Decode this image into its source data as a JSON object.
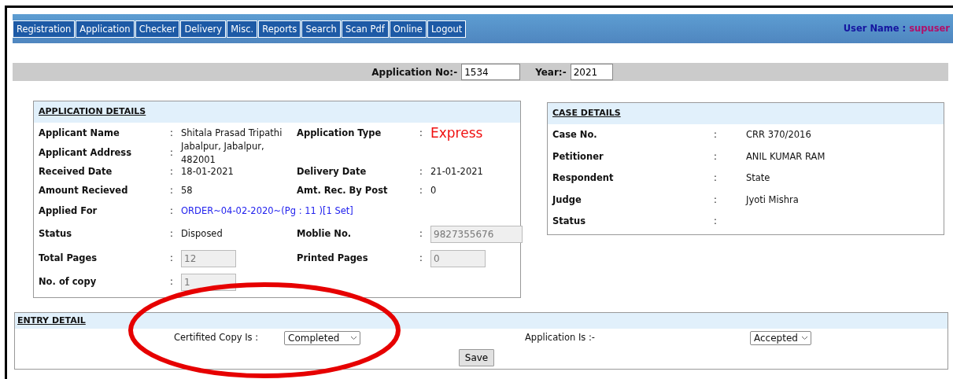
{
  "menu": [
    {
      "label": "Registration"
    },
    {
      "label": "Application"
    },
    {
      "label": "Checker"
    },
    {
      "label": "Delivery"
    },
    {
      "label": "Misc."
    },
    {
      "label": "Reports"
    },
    {
      "label": "Search"
    },
    {
      "label": "Scan Pdf"
    },
    {
      "label": "Online"
    },
    {
      "label": "Logout"
    }
  ],
  "user": {
    "label": "User Name :",
    "value": "supuser"
  },
  "lookup": {
    "application_label": "Application No:-",
    "application_no": "1534",
    "year_label": "Year:-",
    "year": "2021"
  },
  "application_details": {
    "title": "APPLICATION DETAILS",
    "rows": [
      [
        {
          "label": "Applicant Name",
          "separator": ":",
          "value": "Shitala Prasad Tripathi",
          "kind": "text"
        },
        {
          "label": "Application Type",
          "separator": ":",
          "value": "Express",
          "kind": "emphasis"
        }
      ],
      [
        {
          "label": "Applicant Address",
          "separator": ":",
          "value": "Jabalpur, Jabalpur, 482001",
          "kind": "text"
        }
      ],
      [
        {
          "label": "Received Date",
          "separator": ":",
          "value": "18-01-2021",
          "kind": "text"
        },
        {
          "label": "Delivery Date",
          "separator": ":",
          "value": "21-01-2021",
          "kind": "text"
        }
      ],
      [
        {
          "label": "Amount Recieved",
          "separator": ":",
          "value": "58",
          "kind": "text"
        },
        {
          "label": "Amt. Rec. By Post",
          "separator": ":",
          "value": "0",
          "kind": "text"
        }
      ],
      [
        {
          "label": "Applied For",
          "separator": ":",
          "value": "ORDER~04-02-2020~(Pg : 11 )[1 Set]",
          "kind": "link"
        }
      ],
      [
        {
          "label": "Status",
          "separator": ":",
          "value": "Disposed",
          "kind": "text"
        },
        {
          "label": "Moblie No.",
          "separator": ":",
          "value": "9827355676",
          "kind": "field",
          "disabled": true
        }
      ],
      [
        {
          "label": "Total Pages",
          "separator": ":",
          "value": "12",
          "kind": "field",
          "disabled": true
        },
        {
          "label": "Printed Pages",
          "separator": ":",
          "value": "0",
          "kind": "field",
          "disabled": true
        }
      ],
      [
        {
          "label": "No. of copy",
          "separator": ":",
          "value": "1",
          "kind": "field",
          "disabled": true
        }
      ]
    ]
  },
  "case_details": {
    "title": "CASE DETAILS",
    "rows": [
      {
        "label": "Case No.",
        "separator": ":",
        "value": "CRR 370/2016"
      },
      {
        "label": "Petitioner",
        "separator": ":",
        "value": "ANIL KUMAR RAM"
      },
      {
        "label": "Respondent",
        "separator": ":",
        "value": "State"
      },
      {
        "label": "Judge",
        "separator": ":",
        "value": "Jyoti Mishra"
      },
      {
        "label": "Status",
        "separator": ":"
      }
    ]
  },
  "entry_detail": {
    "title": "ENTRY DETAIL",
    "certified_label": "Certifited Copy Is :",
    "certified_value": "Completed",
    "application_label": "Application Is :-",
    "application_value": "Accepted",
    "save": "Save"
  }
}
